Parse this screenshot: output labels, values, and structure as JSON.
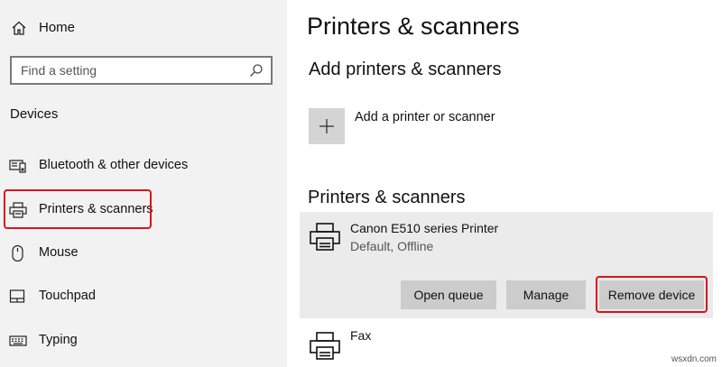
{
  "sidebar": {
    "home_label": "Home",
    "search_placeholder": "Find a setting",
    "section_title": "Devices",
    "items": [
      {
        "label": "Bluetooth & other devices",
        "icon": "bluetooth-devices-icon"
      },
      {
        "label": "Printers & scanners",
        "icon": "printer-icon",
        "selected": true
      },
      {
        "label": "Mouse",
        "icon": "mouse-icon"
      },
      {
        "label": "Touchpad",
        "icon": "touchpad-icon"
      },
      {
        "label": "Typing",
        "icon": "keyboard-icon"
      }
    ]
  },
  "main": {
    "title": "Printers & scanners",
    "add_heading": "Add printers & scanners",
    "add_label": "Add a printer or scanner",
    "list_heading": "Printers & scanners",
    "printers": [
      {
        "name": "Canon E510 series Printer",
        "status": "Default, Offline",
        "buttons": {
          "open_queue": "Open queue",
          "manage": "Manage",
          "remove_device": "Remove device"
        }
      },
      {
        "name": "Fax"
      }
    ]
  },
  "watermark": "wsxdn.com",
  "colors": {
    "sidebar_bg": "#f2f2f2",
    "highlight": "#d9141b",
    "panel_bg": "#ebebeb",
    "button_bg": "#cccccc"
  }
}
